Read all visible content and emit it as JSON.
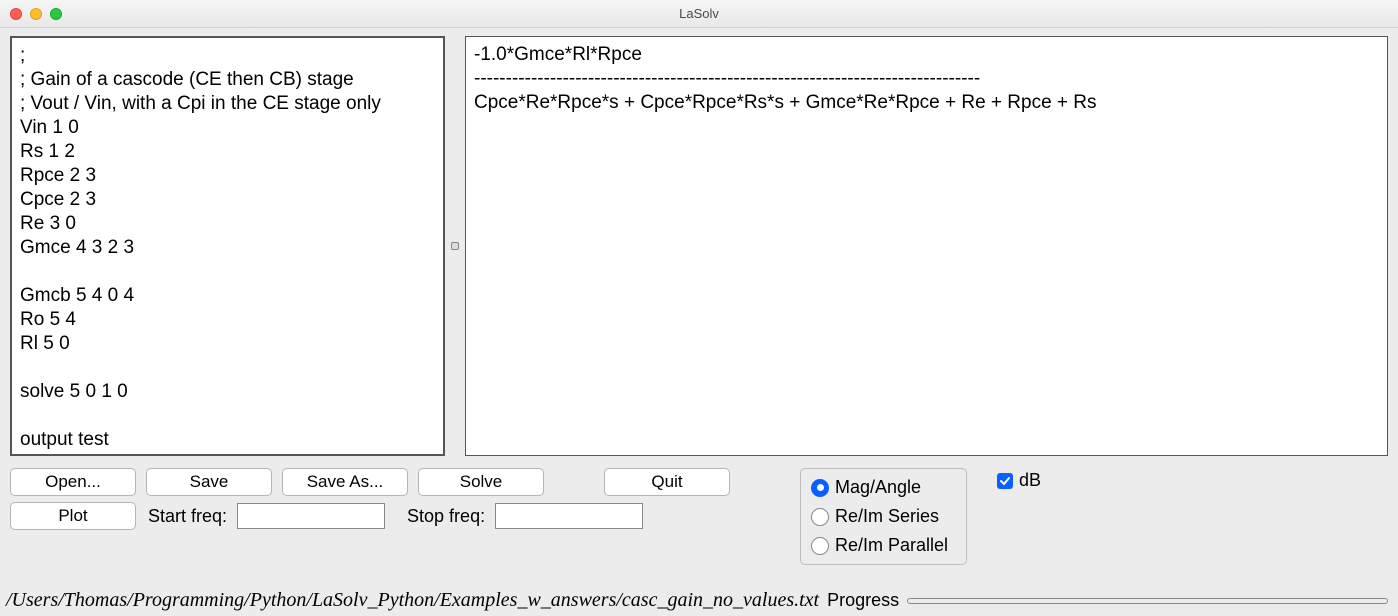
{
  "window": {
    "title": "LaSolv"
  },
  "editor": {
    "input_text": ";\n; Gain of a cascode (CE then CB) stage\n; Vout / Vin, with a Cpi in the CE stage only\nVin 1 0\nRs 1 2\nRpce 2 3\nCpce 2 3\nRe 3 0\nGmce 4 3 2 3\n\nGmcb 5 4 0 4\nRo 5 4\nRl 5 0\n\nsolve 5 0 1 0\n\noutput test",
    "output_text": "-1.0*Gmce*Rl*Rpce\n--------------------------------------------------------------------------------\nCpce*Re*Rpce*s + Cpce*Rpce*Rs*s + Gmce*Re*Rpce + Re + Rpce + Rs"
  },
  "buttons": {
    "open": "Open...",
    "save": "Save",
    "save_as": "Save As...",
    "solve": "Solve",
    "quit": "Quit",
    "plot": "Plot"
  },
  "freq": {
    "start_label": "Start freq:",
    "stop_label": "Stop freq:",
    "start_value": "",
    "stop_value": ""
  },
  "radio": {
    "mag_angle": "Mag/Angle",
    "re_im_series": "Re/Im Series",
    "re_im_parallel": "Re/Im Parallel",
    "selected": "mag_angle"
  },
  "checkbox": {
    "db_label": "dB",
    "db_checked": true
  },
  "status": {
    "path": "/Users/Thomas/Programming/Python/LaSolv_Python/Examples_w_answers/casc_gain_no_values.txt",
    "progress_label": "Progress"
  }
}
